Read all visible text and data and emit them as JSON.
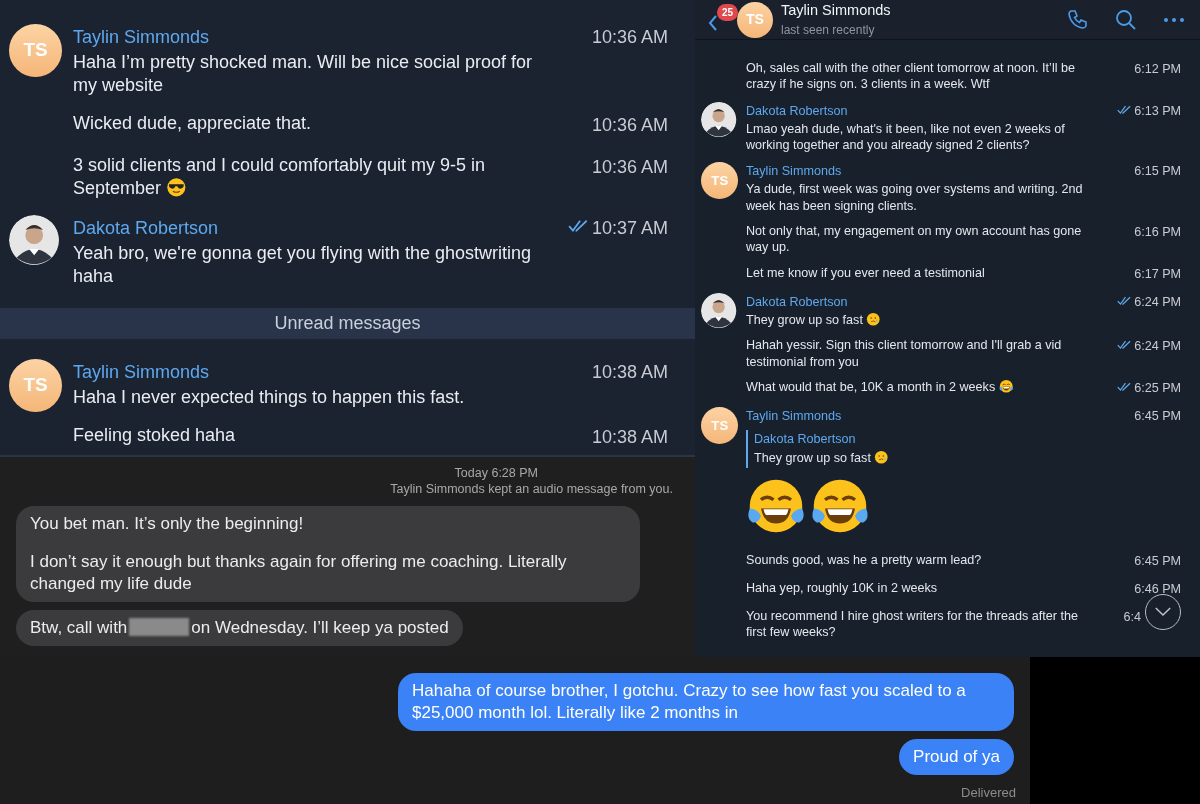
{
  "left_chat": {
    "groups": [
      {
        "kind": "initials",
        "sender": "Taylin Simmonds",
        "initials": "TS",
        "messages": [
          {
            "text": "Haha I’m pretty shocked man. Will be nice social proof for my website",
            "time": "10:36 AM",
            "read": false
          },
          {
            "text": "Wicked dude, appreciate that.",
            "time": "10:36 AM",
            "read": false
          },
          {
            "text": "3 solid clients and I could comfortably quit my 9-5 in September",
            "trailing_icon": {
              "kind": "sunglasses"
            },
            "time": "10:36 AM",
            "read": false
          }
        ]
      },
      {
        "kind": "photo",
        "sender": "Dakota Robertson",
        "messages": [
          {
            "text": "Yeah bro, we're gonna get you flying with the ghostwriting haha",
            "time": "10:37 AM",
            "read": true
          }
        ]
      }
    ],
    "divider": "Unread messages",
    "groups_after": [
      {
        "kind": "initials",
        "sender": "Taylin Simmonds",
        "initials": "TS",
        "messages": [
          {
            "text": "Haha I never expected things to happen this fast.",
            "time": "10:38 AM",
            "read": false
          },
          {
            "text": "Feeling stoked haha",
            "time": "10:38 AM",
            "read": false
          }
        ]
      }
    ]
  },
  "right_chat": {
    "header": {
      "unread_badge": "25",
      "initials": "TS",
      "title": "Taylin Simmonds",
      "status": "last seen recently"
    },
    "groups": [
      {
        "kind": "continuation",
        "messages": [
          {
            "text": "Oh, sales call with the other client tomorrow at noon. It’ll be crazy if he signs on. 3 clients in a week. Wtf",
            "time": "6:12 PM",
            "read": false
          }
        ]
      },
      {
        "kind": "photo",
        "sender": "Dakota Robertson",
        "messages": [
          {
            "text": "Lmao yeah dude, what's it been, like not even 2 weeks of working together and you already signed 2 clients?",
            "time": "6:13 PM",
            "read": true
          }
        ]
      },
      {
        "kind": "initials",
        "sender": "Taylin Simmonds",
        "initials": "TS",
        "messages": [
          {
            "text": "Ya dude, first week was going over systems and writing. 2nd week has been signing clients.",
            "time": "6:15 PM",
            "read": false
          },
          {
            "text": "Not only that, my engagement on my own account has gone way up.",
            "time": "6:16 PM",
            "read": false
          },
          {
            "text": "Let me know if you ever need a testimonial",
            "time": "6:17 PM",
            "read": false
          }
        ]
      },
      {
        "kind": "photo",
        "sender": "Dakota Robertson",
        "messages": [
          {
            "text": "They grow up so fast",
            "trailing_icon": {
              "kind": "tear"
            },
            "time": "6:24 PM",
            "read": true
          },
          {
            "text": "Hahah yessir. Sign this client tomorrow and I'll grab a vid testimonial from you",
            "time": "6:24 PM",
            "read": true
          },
          {
            "text": "What would that be, 10K a month in 2 weeks",
            "trailing_icon": {
              "kind": "laugh"
            },
            "time": "6:25 PM",
            "read": true
          }
        ]
      },
      {
        "kind": "initials",
        "sender": "Taylin Simmonds",
        "initials": "TS",
        "messages": [
          {
            "reply": {
              "name": "Dakota Robertson",
              "text": "They grow up so fast",
              "trailing_icon": {
                "kind": "tear"
              }
            },
            "big_emoji": [
              {
                "kind": "laugh"
              },
              {
                "kind": "laugh"
              }
            ],
            "time": "6:45 PM",
            "read": false
          },
          {
            "text": "Sounds good, was he a pretty warm lead?",
            "time": "6:45 PM",
            "read": false
          },
          {
            "text": "Haha yep, roughly 10K in 2 weeks",
            "time": "6:46 PM",
            "read": false
          },
          {
            "text": "You recommend I hire ghost writers for the threads after the first few weeks?",
            "time": "6:4",
            "read": false
          }
        ]
      }
    ]
  },
  "imessage_top": {
    "timestamp": "Today 6:28 PM",
    "notice": "Taylin Simmonds kept an audio message from you.",
    "bubbles": [
      {
        "kind": "incoming",
        "paragraphs": [
          "You bet man. It’s only the beginning!",
          "I don’t say it enough but thanks again for offering me coaching. Literally changed my life dude"
        ]
      },
      {
        "kind": "incoming",
        "parts": [
          "Btw, call with",
          "on Wednesday. I’ll keep ya posted"
        ],
        "redacted": true
      }
    ]
  },
  "imessage_bottom": {
    "bubbles": [
      {
        "kind": "outgoing",
        "paragraphs": [
          "Hahaha of course brother, I gotchu. Crazy to see how fast you scaled to a $25,000 month lol. Literally like 2 months in"
        ]
      },
      {
        "kind": "outgoing",
        "paragraphs": [
          "Proud of ya"
        ]
      }
    ],
    "status": "Delivered"
  }
}
